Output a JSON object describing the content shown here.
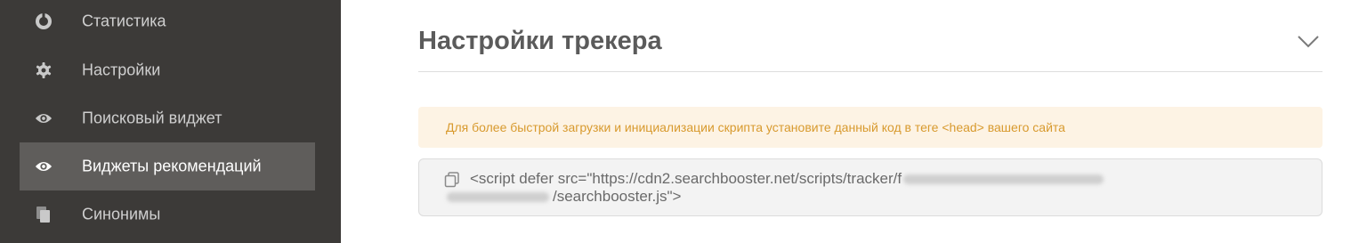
{
  "sidebar": {
    "items": [
      {
        "label": "Статистика",
        "icon": "chart-pie-icon",
        "active": false
      },
      {
        "label": "Настройки",
        "icon": "gear-icon",
        "active": false
      },
      {
        "label": "Поисковый виджет",
        "icon": "eye-icon",
        "active": false
      },
      {
        "label": "Виджеты рекомендаций",
        "icon": "eye-icon",
        "active": true
      },
      {
        "label": "Синонимы",
        "icon": "copy-icon",
        "active": false
      }
    ]
  },
  "main": {
    "section_title": "Настройки трекера",
    "notice": "Для более быстрой загрузки и инициализации скрипта установите данный код в теге <head> вашего сайта",
    "code": {
      "line1": "<script defer src=\"https://cdn2.searchbooster.net/scripts/tracker/f",
      "line2": "/searchbooster.js\">"
    }
  },
  "colors": {
    "sidebar_bg": "#3c3a38",
    "sidebar_active_bg": "#5f5d5b",
    "notice_bg": "#fdf3e4",
    "notice_text": "#d89a2e",
    "title_text": "#5b5b5b"
  }
}
